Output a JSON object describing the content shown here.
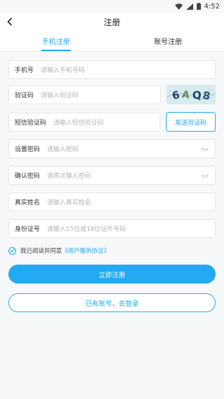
{
  "status": {
    "time": "4:52"
  },
  "nav": {
    "title": "注册"
  },
  "tabs": [
    {
      "label": "手机注册",
      "active": true
    },
    {
      "label": "账号注册",
      "active": false
    }
  ],
  "fields": {
    "phone": {
      "label": "手机号",
      "placeholder": "请输入手机号码"
    },
    "captcha": {
      "label": "验证码",
      "placeholder": "请输入验证码",
      "captcha_text": "6AQ8"
    },
    "sms": {
      "label": "短信验证码",
      "placeholder": "请输入短信验证码",
      "button": "发送验证码"
    },
    "password": {
      "label": "设置密码",
      "placeholder": "请输入密码"
    },
    "confirm": {
      "label": "确认密码",
      "placeholder": "请再次输入密码"
    },
    "realname": {
      "label": "真实姓名",
      "placeholder": "请输入真实姓名"
    },
    "idcard": {
      "label": "身份证号",
      "placeholder": "请输入15位或18位证件号码"
    }
  },
  "agreement": {
    "text": "我已阅读并同意",
    "link": "《用户服务协议》",
    "checked": true
  },
  "buttons": {
    "register": "立即注册",
    "login": "已有账号，去登录"
  },
  "colors": {
    "accent": "#23a9ec",
    "background": "#f7f8fa"
  }
}
